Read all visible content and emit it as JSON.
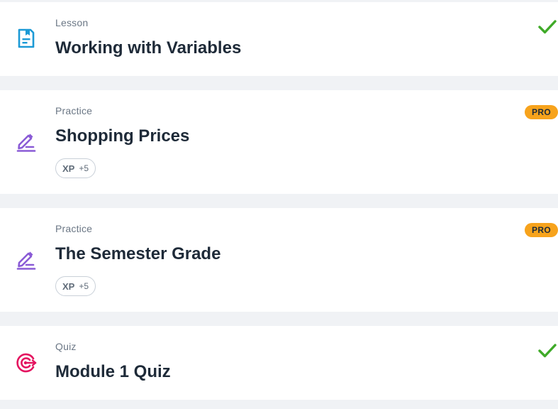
{
  "colors": {
    "page_background": "#f0f2f5",
    "card_background": "#ffffff",
    "lesson_icon": "#1c9ad6",
    "practice_icon": "#8a5bd6",
    "quiz_icon": "#e4135f",
    "check": "#3faa28",
    "pro_badge": "#f7a31c"
  },
  "items": [
    {
      "type": "Lesson",
      "title": "Working with Variables",
      "icon": "lesson-book-icon",
      "completed": true
    },
    {
      "type": "Practice",
      "title": "Shopping Prices",
      "icon": "pencil-edit-icon",
      "badge": "PRO",
      "xp_label": "XP",
      "xp_value": "+5"
    },
    {
      "type": "Practice",
      "title": "The Semester Grade",
      "icon": "pencil-edit-icon",
      "badge": "PRO",
      "xp_label": "XP",
      "xp_value": "+5"
    },
    {
      "type": "Quiz",
      "title": "Module 1 Quiz",
      "icon": "target-icon",
      "completed": true
    }
  ]
}
